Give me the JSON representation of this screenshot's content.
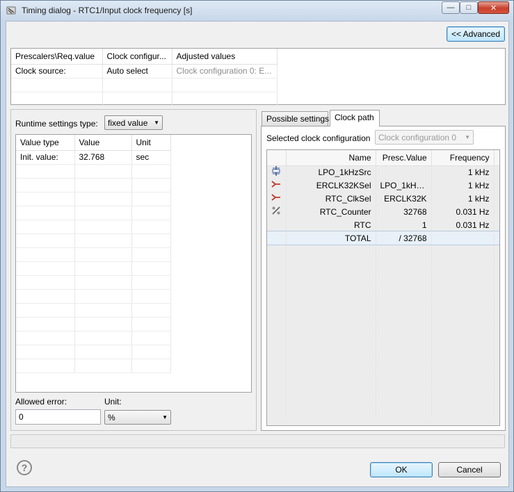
{
  "window": {
    "title": "Timing dialog - RTC1/Input clock frequency [s]",
    "controls": {
      "minimize": "—",
      "maximize": "□",
      "close": "✕"
    }
  },
  "advanced_button": "<< Advanced",
  "top_table": {
    "headers": [
      "Prescalers\\Req.value",
      "Clock configur...",
      "Adjusted values"
    ],
    "rows": [
      [
        "Clock source:",
        "Auto select",
        "Clock configuration 0: E..."
      ]
    ]
  },
  "runtime": {
    "type_label": "Runtime settings type:",
    "type_value": "fixed value",
    "table_headers": [
      "Value type",
      "Value",
      "Unit"
    ],
    "rows": [
      [
        "Init. value:",
        "32.768",
        "sec"
      ]
    ],
    "allowed_error_label": "Allowed error:",
    "allowed_error_value": "0",
    "unit_label": "Unit:",
    "unit_value": "%"
  },
  "tabs": {
    "possible_settings": "Possible settings",
    "clock_path": "Clock path"
  },
  "clock_path": {
    "selected_label": "Selected clock configuration",
    "selected_value": "Clock configuration 0",
    "headers": [
      "Name",
      "Presc.Value",
      "Frequency"
    ],
    "rows": [
      {
        "icon": "oscillator-icon",
        "name": "LPO_1kHzSrc",
        "presc": "",
        "freq": "1 kHz"
      },
      {
        "icon": "selector-icon",
        "name": "ERCLK32KSel",
        "presc": "LPO_1kHz...",
        "freq": "1 kHz"
      },
      {
        "icon": "selector-icon",
        "name": "RTC_ClkSel",
        "presc": "ERCLK32K",
        "freq": "1 kHz"
      },
      {
        "icon": "divider-icon",
        "name": "RTC_Counter",
        "presc": "32768",
        "freq": "0.031 Hz"
      },
      {
        "icon": "",
        "name": "RTC",
        "presc": "1",
        "freq": "0.031 Hz"
      },
      {
        "icon": "",
        "name": "TOTAL",
        "presc": "/ 32768",
        "freq": ""
      }
    ]
  },
  "footer": {
    "help": "?",
    "ok": "OK",
    "cancel": "Cancel"
  },
  "colors": {
    "accent": "#3c7fb1",
    "selected_row": "#e8f0f8",
    "selector_icon": "#c0392b"
  }
}
